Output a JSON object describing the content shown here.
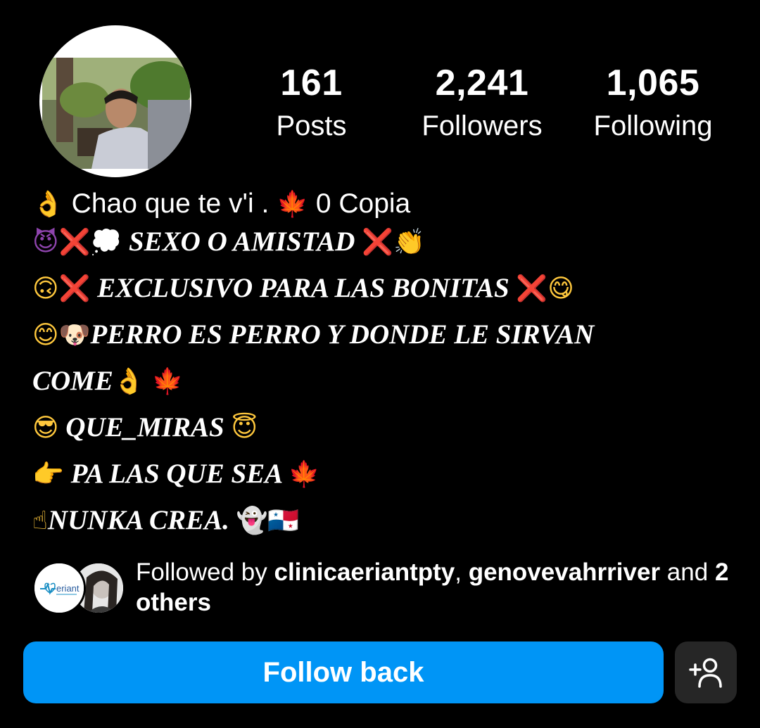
{
  "profile": {
    "stats": [
      {
        "value": "161",
        "label": "Posts"
      },
      {
        "value": "2,241",
        "label": "Followers"
      },
      {
        "value": "1,065",
        "label": "Following"
      }
    ]
  },
  "bio": {
    "name_text": "Chao que te v'i .",
    "name_suffix": "0 Copia",
    "lines": [
      "SEXO O AMISTAD",
      "EXCLUSIVO PARA LAS BONITAS",
      "PERRO ES PERRO Y DONDE LE SIRVAN",
      "COME",
      "QUE_MIRAS",
      "PA LAS QUE SEA",
      "NUNKA CREA."
    ]
  },
  "followed_by": {
    "prefix": "Followed by ",
    "user1": "clinicaeriantpty",
    "separator": ", ",
    "user2": "genovevahrriver",
    "middle": " and ",
    "count": "2",
    "suffix": "others",
    "avatar1_text": "eriant"
  },
  "actions": {
    "follow_back_label": "Follow back",
    "suggest_icon": "add-person-icon"
  },
  "colors": {
    "background": "#000000",
    "primary_button": "#0095f6",
    "secondary_button": "#262626",
    "text": "#ffffff"
  }
}
